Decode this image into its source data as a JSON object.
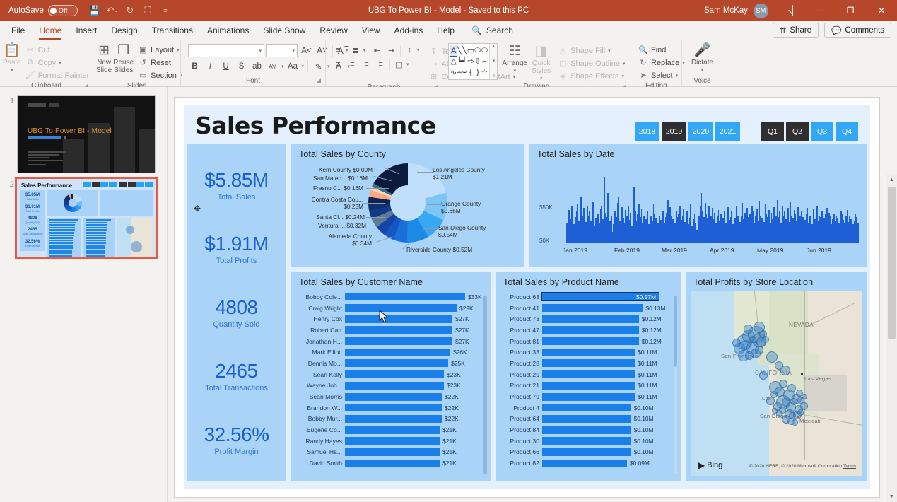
{
  "titlebar": {
    "autosave_label": "AutoSave",
    "autosave_state": "Off",
    "qat": [
      {
        "name": "save-icon",
        "glyph": "💾"
      },
      {
        "name": "undo-icon",
        "glyph": "↶"
      },
      {
        "name": "redo-icon",
        "glyph": "↻"
      },
      {
        "name": "start-presentation-icon",
        "glyph": "⬜"
      },
      {
        "name": "customize-quick-access-toolbar-icon",
        "glyph": "⌄"
      }
    ],
    "document_title": "UBG To Power BI - Model  -  Saved to this PC",
    "user_name": "Sam McKay",
    "avatar_initials": "SM",
    "window_buttons": [
      {
        "name": "ribbon-display-options-icon",
        "glyph": "⌷"
      },
      {
        "name": "minimize-icon",
        "glyph": "─"
      },
      {
        "name": "restore-icon",
        "glyph": "❐"
      },
      {
        "name": "close-icon",
        "glyph": "✕"
      }
    ]
  },
  "tabs": [
    "File",
    "Home",
    "Insert",
    "Design",
    "Transitions",
    "Animations",
    "Slide Show",
    "Review",
    "View",
    "Add-ins",
    "Help"
  ],
  "active_tab": "Home",
  "search": {
    "label": "Search"
  },
  "tabstrip_right": {
    "share_label": "Share",
    "comments_label": "Comments"
  },
  "ribbon": {
    "groups": [
      {
        "name": "Clipboard",
        "big": [
          {
            "label": "Paste",
            "icon": "paste-icon",
            "glyph": "📋",
            "dim": true
          }
        ],
        "small": [
          {
            "label": "Cut",
            "icon": "cut-icon",
            "glyph": "✂",
            "dim": true
          },
          {
            "label": "Copy",
            "icon": "copy-icon",
            "glyph": "⧉",
            "dim": true,
            "caret": true
          },
          {
            "label": "Format Painter",
            "icon": "format-painter-icon",
            "glyph": "🖌",
            "dim": true
          }
        ]
      },
      {
        "name": "Slides",
        "big": [
          {
            "label": "New Slide",
            "icon": "new-slide-icon",
            "glyph": "⊞",
            "caret": true
          },
          {
            "label": "Reuse Slides",
            "icon": "reuse-slides-icon",
            "glyph": "❐"
          }
        ],
        "small": [
          {
            "label": "Layout",
            "icon": "layout-icon",
            "glyph": "▣",
            "caret": true
          },
          {
            "label": "Reset",
            "icon": "reset-icon",
            "glyph": "↺"
          },
          {
            "label": "Section",
            "icon": "section-icon",
            "glyph": "▭",
            "caret": true
          }
        ]
      },
      {
        "name": "Font",
        "font_name_value": "",
        "font_size_value": "",
        "buttons_row1": [
          {
            "label": "A˄",
            "name": "increase-font-size-button"
          },
          {
            "label": "A˅",
            "name": "decrease-font-size-button"
          },
          {
            "label": "A⊘",
            "name": "clear-formatting-button"
          }
        ],
        "buttons_row2": [
          {
            "label": "B",
            "name": "bold-button"
          },
          {
            "label": "I",
            "name": "italic-button"
          },
          {
            "label": "U",
            "name": "underline-button"
          },
          {
            "label": "S",
            "name": "text-shadow-button"
          },
          {
            "label": "ab",
            "name": "strikethrough-button"
          },
          {
            "label": "AV",
            "name": "character-spacing-button"
          },
          {
            "label": "Aa",
            "name": "change-case-button"
          },
          {
            "label": "✐",
            "name": "text-highlight-color-button"
          },
          {
            "label": "A",
            "name": "font-color-button"
          }
        ]
      },
      {
        "name": "Paragraph",
        "row1": [
          "bullets-button",
          "numbering-button",
          "decrease-indent-button",
          "increase-indent-button",
          "line-spacing-button",
          "text-direction-placeholder"
        ],
        "row2": [
          "align-left-button",
          "align-center-button",
          "align-right-button",
          "justify-button",
          "columns-button"
        ],
        "right_items": [
          {
            "label": "Text Direction",
            "icon": "text-direction-icon",
            "glyph": "↧",
            "dim": true,
            "caret": true
          },
          {
            "label": "Align Text",
            "icon": "align-text-icon",
            "glyph": "⌸",
            "dim": true,
            "caret": true
          },
          {
            "label": "Convert to SmartArt",
            "icon": "smartart-icon",
            "glyph": "⊞",
            "dim": true,
            "caret": true
          }
        ]
      },
      {
        "name": "Drawing",
        "shapes": [
          "A",
          "╲",
          "╲",
          "▭",
          "⬭",
          "⬭",
          "△",
          "┗",
          "┙",
          "⇨",
          "⇩",
          "⌐",
          "∿",
          "⌢",
          "⌣",
          "{",
          "}",
          "☆"
        ],
        "arrange_label": "Arrange",
        "quick_styles_label": "Quick Styles",
        "small": [
          {
            "label": "Shape Fill",
            "icon": "shape-fill-icon",
            "glyph": "△",
            "dim": true,
            "caret": true
          },
          {
            "label": "Shape Outline",
            "icon": "shape-outline-icon",
            "glyph": "◱",
            "dim": true,
            "caret": true
          },
          {
            "label": "Shape Effects",
            "icon": "shape-effects-icon",
            "glyph": "◈",
            "dim": true,
            "caret": true
          }
        ]
      },
      {
        "name": "Editing",
        "small": [
          {
            "label": "Find",
            "icon": "find-icon",
            "glyph": "🔍"
          },
          {
            "label": "Replace",
            "icon": "replace-icon",
            "glyph": "↻",
            "caret": true
          },
          {
            "label": "Select",
            "icon": "select-icon",
            "glyph": "➤",
            "caret": true
          }
        ]
      },
      {
        "name": "Voice",
        "big": [
          {
            "label": "Dictate",
            "icon": "microphone-icon",
            "glyph": "🎤",
            "caret": true
          }
        ]
      }
    ]
  },
  "slides_pane": {
    "slide1": {
      "number": "1",
      "title": "UBG To Power BI - Model"
    },
    "slide2": {
      "number": "2",
      "title": "Sales Performance",
      "selected": true
    }
  },
  "dashboard": {
    "title": "Sales Performance",
    "year_slicer": {
      "options": [
        "2018",
        "2019",
        "2020",
        "2021"
      ],
      "selected": [
        "2019"
      ]
    },
    "quarter_slicer": {
      "options": [
        "Q1",
        "Q2",
        "Q3",
        "Q4"
      ],
      "selected": [
        "Q1",
        "Q2"
      ]
    },
    "kpis": [
      {
        "value": "$5.85M",
        "label": "Total Sales"
      },
      {
        "value": "$1.91M",
        "label": "Total Profits"
      },
      {
        "value": "4808",
        "label": "Quantity Sold"
      },
      {
        "value": "2465",
        "label": "Total Transactions"
      },
      {
        "value": "32.56%",
        "label": "Profit Margin"
      }
    ],
    "colors": {
      "accent": "#1a7fe8",
      "panel": "#a9d3f7",
      "background": "#e4f0fd",
      "slicer_on": "#2f2f2f",
      "slicer_off": "#31a7f5",
      "kpi_text": "#1a5fd0"
    },
    "map_panel": {
      "title": "Total Profits by Store Location",
      "provider": "Bing",
      "attribution": "© 2020 HERE, © 2020 Microsoft Corporation",
      "terms_label": "Terms",
      "labels": [
        "NEVADA",
        "CALIFORNIA",
        "Las Vegas",
        "San Francisco",
        "Los",
        "San Diego",
        "Mexicali"
      ]
    }
  },
  "chart_data": [
    {
      "type": "pie",
      "title": "Total Sales by County",
      "labels": [
        "Los Angeles County",
        "Orange County",
        "San Diego County",
        "Riverside County",
        "Alameda County",
        "Ventura ...",
        "Santa Cl...",
        "Contra Costa Cou...",
        "Fresno C...",
        "San Mateo...",
        "Kern County"
      ],
      "value_labels": [
        "$1.21M",
        "$0.66M",
        "$0.54M",
        "$0.52M",
        "$0.34M",
        "$0.32M",
        "$0.24M",
        "$0.23M",
        "$0.16M",
        "$0.16M",
        "$0.09M"
      ],
      "values": [
        1.21,
        0.66,
        0.54,
        0.52,
        0.34,
        0.32,
        0.24,
        0.23,
        0.16,
        0.16,
        0.09
      ],
      "legend": "labels-outside",
      "unit": "M"
    },
    {
      "type": "bar",
      "title": "Total Sales by Date",
      "xlabel": "",
      "ylabel": "",
      "ylim": [
        0,
        75
      ],
      "ytick_labels": [
        "$0K",
        "$50K"
      ],
      "xtick_labels": [
        "Jan 2019",
        "Feb 2019",
        "Mar 2019",
        "Apr 2019",
        "May 2019",
        "Jun 2019"
      ],
      "values": [
        22,
        30,
        36,
        26,
        41,
        33,
        20,
        28,
        35,
        43,
        24,
        33,
        50,
        30,
        38,
        27,
        23,
        40,
        30,
        34,
        24,
        29,
        45,
        19,
        27,
        36,
        31,
        22,
        37,
        41,
        26,
        72,
        33,
        28,
        55,
        38,
        24,
        30,
        12,
        20,
        35,
        28,
        44,
        50,
        24,
        31,
        39,
        27,
        22,
        36,
        30,
        41,
        25,
        33,
        18,
        28,
        62,
        35,
        24,
        31,
        43,
        28,
        37,
        22,
        30,
        46,
        26,
        34,
        20,
        39,
        29,
        24,
        43,
        31,
        27,
        36,
        22,
        30,
        25,
        40,
        35,
        21,
        28,
        33,
        47,
        24,
        39,
        30,
        26,
        44,
        22,
        35,
        28,
        31,
        41,
        25,
        30,
        37,
        23,
        29,
        34,
        20,
        27,
        43,
        18,
        26,
        32,
        22,
        14,
        19,
        30,
        40,
        55,
        35,
        28,
        44,
        32,
        27,
        41,
        23,
        30,
        38,
        26,
        33,
        21,
        29,
        36,
        24,
        31,
        43,
        27,
        34,
        22,
        30,
        39,
        25,
        28,
        35,
        20,
        32,
        27,
        41,
        29,
        36,
        23,
        30,
        44,
        26,
        33,
        21,
        38,
        28,
        31,
        25,
        40,
        34,
        22,
        29,
        37,
        24,
        46,
        30,
        27,
        35,
        23,
        42,
        31,
        28,
        36,
        21,
        33,
        26,
        39,
        24,
        30,
        47,
        28,
        35,
        22,
        41,
        29,
        34,
        26,
        31,
        38,
        23,
        45,
        30,
        27,
        36,
        32,
        24,
        39,
        52,
        30,
        35,
        28,
        43,
        25,
        31,
        38,
        22,
        29,
        34,
        20,
        37,
        26,
        33,
        41,
        24,
        30,
        28,
        35,
        22,
        27,
        31,
        38,
        25,
        33,
        29,
        20,
        26,
        32,
        24,
        30,
        27,
        21,
        28,
        34,
        31,
        25,
        22,
        29,
        36,
        23,
        30,
        26,
        33,
        20,
        24,
        31,
        28,
        22
      ]
    },
    {
      "type": "bar",
      "orientation": "horizontal",
      "title": "Total Sales by Customer Name",
      "categories": [
        "Bobby Cole...",
        "Craig Wright",
        "Henry Cox",
        "Robert Carr",
        "Jonathan H...",
        "Mark Elliott",
        "Dennis Mo...",
        "Sean Kelly",
        "Wayne Joh...",
        "Sean Morris",
        "Brandon W...",
        "Bobby Mur...",
        "Eugene Co...",
        "Randy Hayes",
        "Samuel Ha...",
        "David Smith"
      ],
      "value_labels": [
        "$33K",
        "$29K",
        "$27K",
        "$27K",
        "$27K",
        "$26K",
        "$25K",
        "$23K",
        "$23K",
        "$22K",
        "$22K",
        "$22K",
        "$21K",
        "$21K",
        "$21K",
        "$21K"
      ],
      "values": [
        33,
        29,
        27,
        27,
        27,
        26,
        25,
        23,
        23,
        22,
        22,
        22,
        21,
        21,
        21,
        21
      ],
      "unit": "K",
      "scrollable": true
    },
    {
      "type": "bar",
      "orientation": "horizontal",
      "title": "Total Sales by Product Name",
      "categories": [
        "Product 63",
        "Product 41",
        "Product 73",
        "Product 47",
        "Product 81",
        "Product 33",
        "Product 28",
        "Product 29",
        "Product 21",
        "Product 79",
        "Product 4",
        "Product 64",
        "Product 84",
        "Product 30",
        "Product 66",
        "Product 82"
      ],
      "value_labels": [
        "$0.17M",
        "$0.13M",
        "$0.12M",
        "$0.12M",
        "$0.12M",
        "$0.11M",
        "$0.11M",
        "$0.11M",
        "$0.11M",
        "$0.11M",
        "$0.10M",
        "$0.10M",
        "$0.10M",
        "$0.10M",
        "$0.10M",
        "$0.09M"
      ],
      "values": [
        0.17,
        0.13,
        0.12,
        0.12,
        0.12,
        0.11,
        0.11,
        0.11,
        0.11,
        0.11,
        0.1,
        0.1,
        0.1,
        0.1,
        0.1,
        0.09
      ],
      "unit": "M",
      "highlighted_index": 0,
      "scrollable": true
    }
  ]
}
